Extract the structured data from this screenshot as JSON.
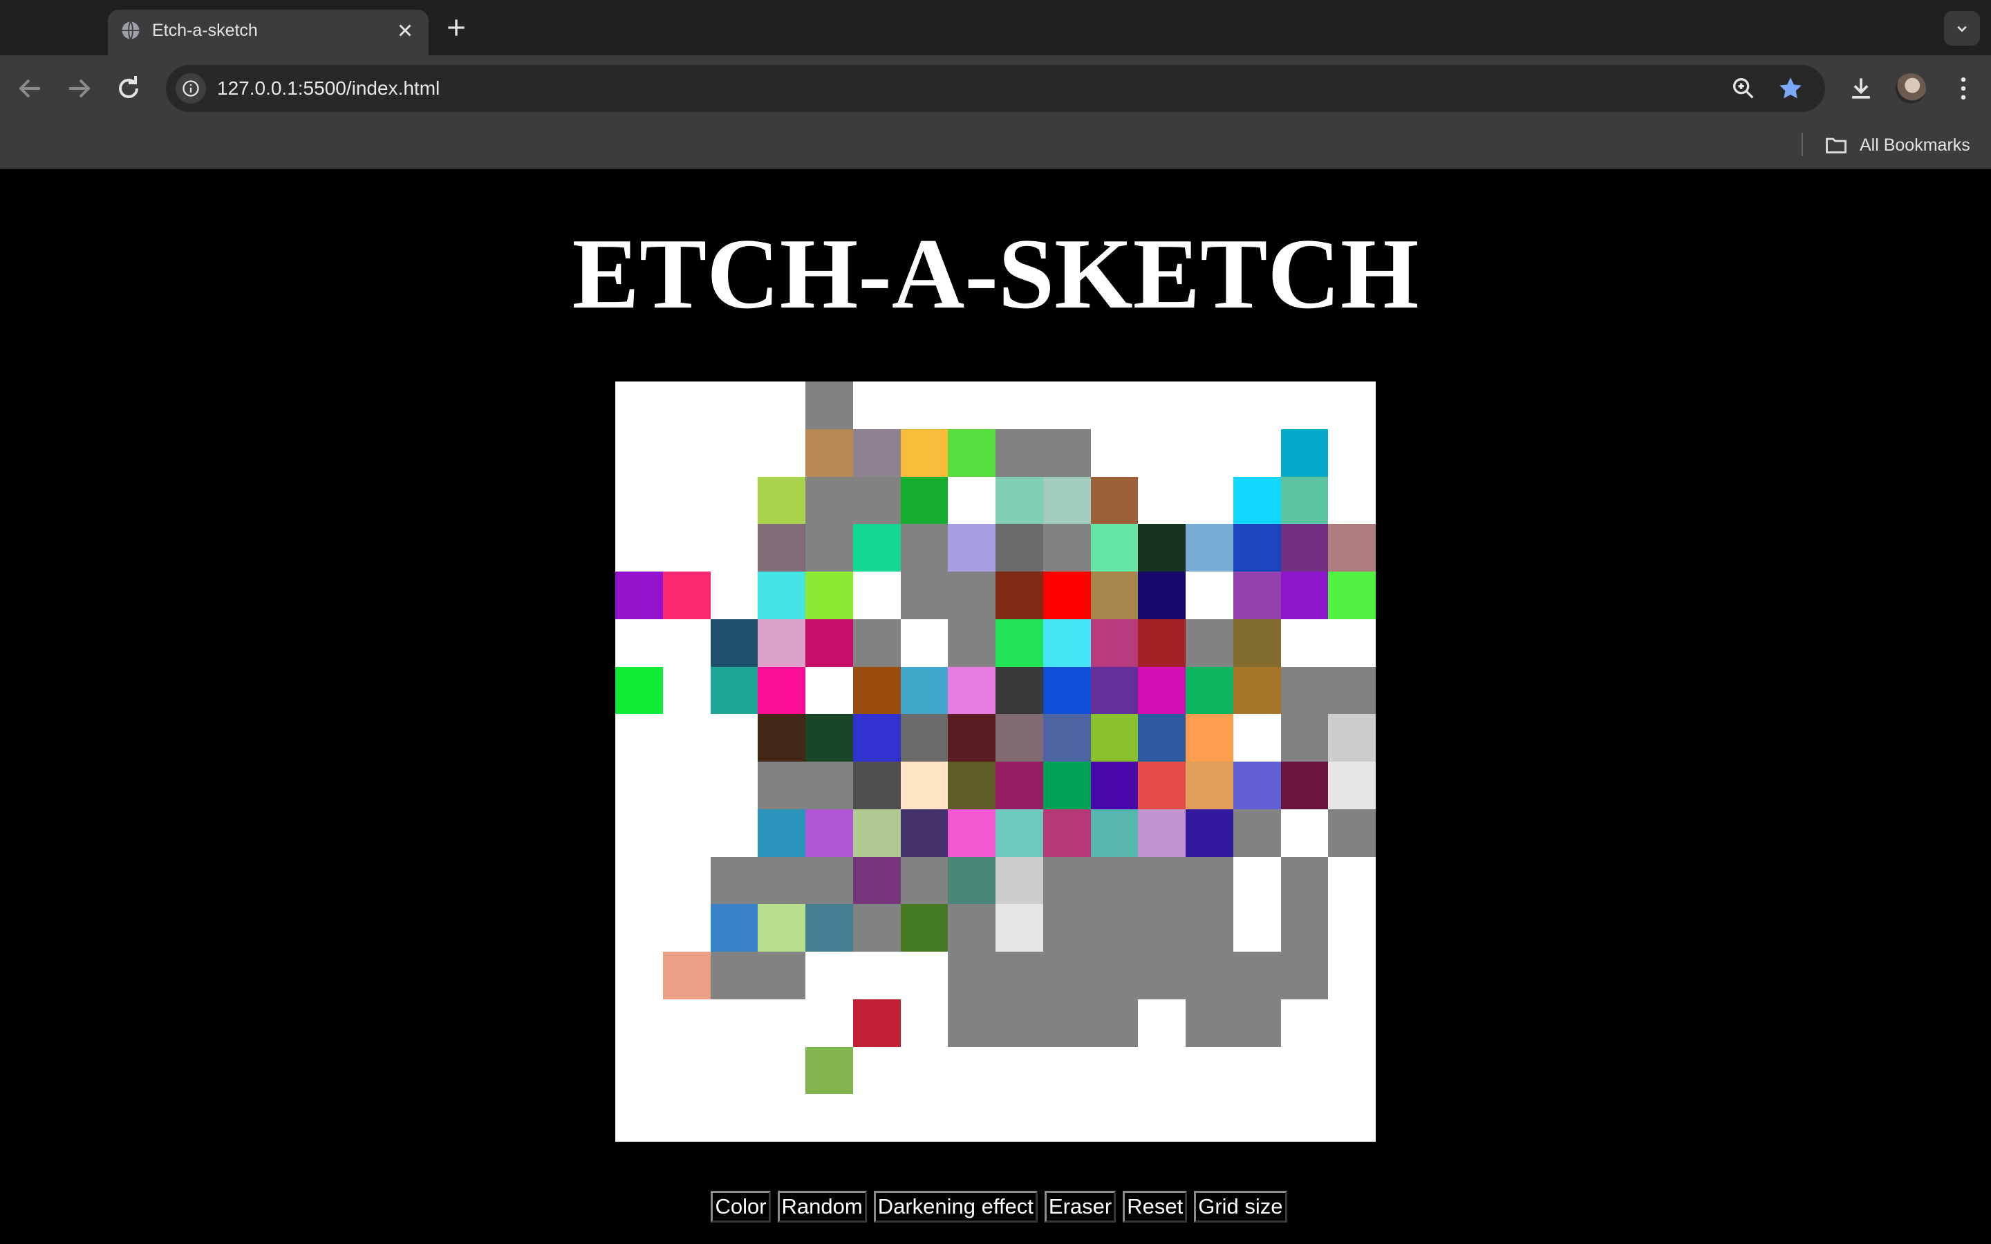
{
  "browser": {
    "tab_title": "Etch-a-sketch",
    "url": "127.0.0.1:5500/index.html",
    "bookmarks_label": "All Bookmarks",
    "icons": [
      "globe-icon",
      "close-icon",
      "plus-icon",
      "chevron-down-icon",
      "back-arrow-icon",
      "forward-arrow-icon",
      "reload-icon",
      "info-icon",
      "zoom-icon",
      "star-icon",
      "download-icon",
      "kebab-menu-icon",
      "folder-icon"
    ]
  },
  "page": {
    "title": "ETCH-A-SKETCH"
  },
  "grid": {
    "size": 16,
    "cells": [
      [
        "#ffffff",
        "#ffffff",
        "#ffffff",
        "#ffffff",
        "#838383",
        "#ffffff",
        "#ffffff",
        "#ffffff",
        "#ffffff",
        "#ffffff",
        "#ffffff",
        "#ffffff",
        "#ffffff",
        "#ffffff",
        "#ffffff",
        "#ffffff"
      ],
      [
        "#ffffff",
        "#ffffff",
        "#ffffff",
        "#ffffff",
        "#b98952",
        "#8e8490",
        "#f9bb3c",
        "#58df3e",
        "#838383",
        "#838383",
        "#ffffff",
        "#ffffff",
        "#ffffff",
        "#ffffff",
        "#04aac9",
        "#ffffff"
      ],
      [
        "#ffffff",
        "#ffffff",
        "#ffffff",
        "#a9d24d",
        "#838383",
        "#838383",
        "#15ae2f",
        "#ffffff",
        "#7ecfb5",
        "#a2cabd",
        "#9c603a",
        "#ffffff",
        "#ffffff",
        "#10d7fb",
        "#5cc59f",
        "#ffffff"
      ],
      [
        "#ffffff",
        "#ffffff",
        "#ffffff",
        "#816b77",
        "#838383",
        "#12d890",
        "#838383",
        "#a6a0e3",
        "#6a6a6a",
        "#838383",
        "#65e5a6",
        "#163320",
        "#79acd5",
        "#1b45be",
        "#732f7f",
        "#ad7d80"
      ],
      [
        "#9513cc",
        "#fe2870",
        "#ffffff",
        "#45e4e4",
        "#8ce936",
        "#ffffff",
        "#838383",
        "#838383",
        "#812a16",
        "#fe0000",
        "#a7874c",
        "#16096d",
        "#ffffff",
        "#9442ad",
        "#8b16cb",
        "#4ff040"
      ],
      [
        "#ffffff",
        "#ffffff",
        "#1e4f6b",
        "#dca1c9",
        "#c90d6b",
        "#838383",
        "#ffffff",
        "#838383",
        "#20e355",
        "#43e5f6",
        "#b83c7d",
        "#a51f27",
        "#838383",
        "#816c2e",
        "#ffffff",
        "#ffffff"
      ],
      [
        "#11ed37",
        "#ffffff",
        "#1ea696",
        "#fb0c94",
        "#ffffff",
        "#9a4d0e",
        "#41a7cc",
        "#e97de2",
        "#3a3a3a",
        "#0f4ed7",
        "#633099",
        "#d30eb3",
        "#0db460",
        "#a77729",
        "#838383",
        "#838383"
      ],
      [
        "#ffffff",
        "#ffffff",
        "#ffffff",
        "#432717",
        "#194626",
        "#3232d0",
        "#6a6a6a",
        "#5a1c22",
        "#806b70",
        "#4c64a1",
        "#89c12e",
        "#2e5aa0",
        "#fe9d4d",
        "#ffffff",
        "#838383",
        "#cdcdcd"
      ],
      [
        "#ffffff",
        "#ffffff",
        "#ffffff",
        "#838383",
        "#838383",
        "#4f4f4f",
        "#ffe4c8",
        "#5f5d26",
        "#961d63",
        "#00a25a",
        "#4906a8",
        "#e44b47",
        "#e1a05a",
        "#625ed3",
        "#6b163c",
        "#e6e6e6"
      ],
      [
        "#ffffff",
        "#ffffff",
        "#ffffff",
        "#2a94bb",
        "#b155d5",
        "#b0c892",
        "#43326b",
        "#f359d3",
        "#6ec9bc",
        "#b63879",
        "#56b7ae",
        "#c295d1",
        "#32199d",
        "#838383",
        "#ffffff",
        "#838383"
      ],
      [
        "#ffffff",
        "#ffffff",
        "#838383",
        "#838383",
        "#838383",
        "#77357b",
        "#838383",
        "#4a8678",
        "#cdcdcd",
        "#838383",
        "#838383",
        "#838383",
        "#838383",
        "#ffffff",
        "#838383",
        "#ffffff"
      ],
      [
        "#ffffff",
        "#ffffff",
        "#3982c9",
        "#b8e08c",
        "#437f91",
        "#838383",
        "#467a24",
        "#838383",
        "#e6e6e6",
        "#838383",
        "#838383",
        "#838383",
        "#838383",
        "#ffffff",
        "#838383",
        "#ffffff"
      ],
      [
        "#ffffff",
        "#eb9f86",
        "#838383",
        "#838383",
        "#ffffff",
        "#ffffff",
        "#ffffff",
        "#838383",
        "#838383",
        "#838383",
        "#838383",
        "#838383",
        "#838383",
        "#838383",
        "#838383",
        "#ffffff"
      ],
      [
        "#ffffff",
        "#ffffff",
        "#ffffff",
        "#ffffff",
        "#ffffff",
        "#c22135",
        "#ffffff",
        "#838383",
        "#838383",
        "#838383",
        "#838383",
        "#ffffff",
        "#838383",
        "#838383",
        "#ffffff",
        "#ffffff"
      ],
      [
        "#ffffff",
        "#ffffff",
        "#ffffff",
        "#ffffff",
        "#80b44e",
        "#ffffff",
        "#ffffff",
        "#ffffff",
        "#ffffff",
        "#ffffff",
        "#ffffff",
        "#ffffff",
        "#ffffff",
        "#ffffff",
        "#ffffff",
        "#ffffff"
      ],
      [
        "#ffffff",
        "#ffffff",
        "#ffffff",
        "#ffffff",
        "#ffffff",
        "#ffffff",
        "#ffffff",
        "#ffffff",
        "#ffffff",
        "#ffffff",
        "#ffffff",
        "#ffffff",
        "#ffffff",
        "#ffffff",
        "#ffffff",
        "#ffffff"
      ]
    ]
  },
  "controls": {
    "color_label": "Color",
    "random_label": "Random",
    "darkening_label": "Darkening effect",
    "eraser_label": "Eraser",
    "reset_label": "Reset",
    "grid_size_label": "Grid size"
  }
}
